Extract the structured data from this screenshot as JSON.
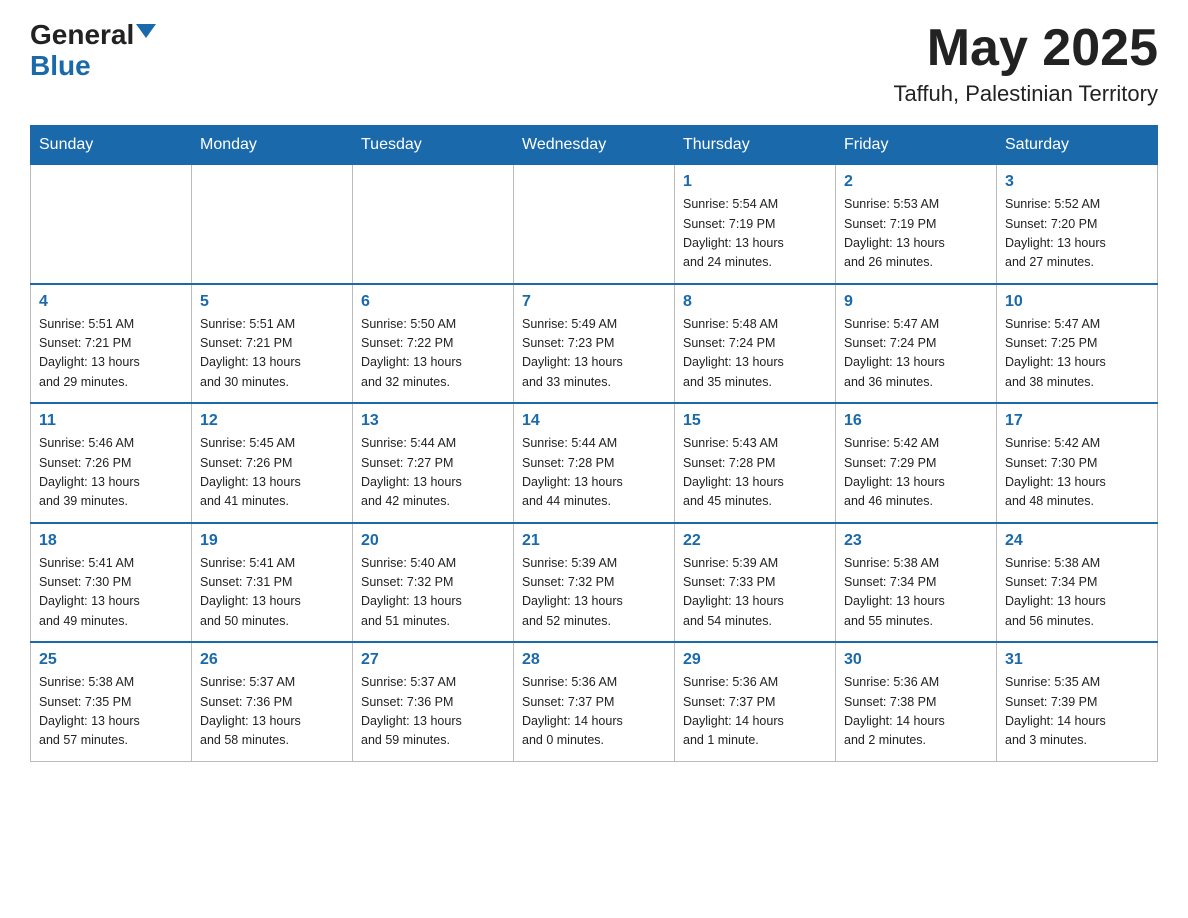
{
  "header": {
    "logo_main": "General",
    "logo_sub": "Blue",
    "title": "May 2025",
    "location": "Taffuh, Palestinian Territory"
  },
  "weekdays": [
    "Sunday",
    "Monday",
    "Tuesday",
    "Wednesday",
    "Thursday",
    "Friday",
    "Saturday"
  ],
  "weeks": [
    [
      {
        "day": "",
        "info": ""
      },
      {
        "day": "",
        "info": ""
      },
      {
        "day": "",
        "info": ""
      },
      {
        "day": "",
        "info": ""
      },
      {
        "day": "1",
        "info": "Sunrise: 5:54 AM\nSunset: 7:19 PM\nDaylight: 13 hours\nand 24 minutes."
      },
      {
        "day": "2",
        "info": "Sunrise: 5:53 AM\nSunset: 7:19 PM\nDaylight: 13 hours\nand 26 minutes."
      },
      {
        "day": "3",
        "info": "Sunrise: 5:52 AM\nSunset: 7:20 PM\nDaylight: 13 hours\nand 27 minutes."
      }
    ],
    [
      {
        "day": "4",
        "info": "Sunrise: 5:51 AM\nSunset: 7:21 PM\nDaylight: 13 hours\nand 29 minutes."
      },
      {
        "day": "5",
        "info": "Sunrise: 5:51 AM\nSunset: 7:21 PM\nDaylight: 13 hours\nand 30 minutes."
      },
      {
        "day": "6",
        "info": "Sunrise: 5:50 AM\nSunset: 7:22 PM\nDaylight: 13 hours\nand 32 minutes."
      },
      {
        "day": "7",
        "info": "Sunrise: 5:49 AM\nSunset: 7:23 PM\nDaylight: 13 hours\nand 33 minutes."
      },
      {
        "day": "8",
        "info": "Sunrise: 5:48 AM\nSunset: 7:24 PM\nDaylight: 13 hours\nand 35 minutes."
      },
      {
        "day": "9",
        "info": "Sunrise: 5:47 AM\nSunset: 7:24 PM\nDaylight: 13 hours\nand 36 minutes."
      },
      {
        "day": "10",
        "info": "Sunrise: 5:47 AM\nSunset: 7:25 PM\nDaylight: 13 hours\nand 38 minutes."
      }
    ],
    [
      {
        "day": "11",
        "info": "Sunrise: 5:46 AM\nSunset: 7:26 PM\nDaylight: 13 hours\nand 39 minutes."
      },
      {
        "day": "12",
        "info": "Sunrise: 5:45 AM\nSunset: 7:26 PM\nDaylight: 13 hours\nand 41 minutes."
      },
      {
        "day": "13",
        "info": "Sunrise: 5:44 AM\nSunset: 7:27 PM\nDaylight: 13 hours\nand 42 minutes."
      },
      {
        "day": "14",
        "info": "Sunrise: 5:44 AM\nSunset: 7:28 PM\nDaylight: 13 hours\nand 44 minutes."
      },
      {
        "day": "15",
        "info": "Sunrise: 5:43 AM\nSunset: 7:28 PM\nDaylight: 13 hours\nand 45 minutes."
      },
      {
        "day": "16",
        "info": "Sunrise: 5:42 AM\nSunset: 7:29 PM\nDaylight: 13 hours\nand 46 minutes."
      },
      {
        "day": "17",
        "info": "Sunrise: 5:42 AM\nSunset: 7:30 PM\nDaylight: 13 hours\nand 48 minutes."
      }
    ],
    [
      {
        "day": "18",
        "info": "Sunrise: 5:41 AM\nSunset: 7:30 PM\nDaylight: 13 hours\nand 49 minutes."
      },
      {
        "day": "19",
        "info": "Sunrise: 5:41 AM\nSunset: 7:31 PM\nDaylight: 13 hours\nand 50 minutes."
      },
      {
        "day": "20",
        "info": "Sunrise: 5:40 AM\nSunset: 7:32 PM\nDaylight: 13 hours\nand 51 minutes."
      },
      {
        "day": "21",
        "info": "Sunrise: 5:39 AM\nSunset: 7:32 PM\nDaylight: 13 hours\nand 52 minutes."
      },
      {
        "day": "22",
        "info": "Sunrise: 5:39 AM\nSunset: 7:33 PM\nDaylight: 13 hours\nand 54 minutes."
      },
      {
        "day": "23",
        "info": "Sunrise: 5:38 AM\nSunset: 7:34 PM\nDaylight: 13 hours\nand 55 minutes."
      },
      {
        "day": "24",
        "info": "Sunrise: 5:38 AM\nSunset: 7:34 PM\nDaylight: 13 hours\nand 56 minutes."
      }
    ],
    [
      {
        "day": "25",
        "info": "Sunrise: 5:38 AM\nSunset: 7:35 PM\nDaylight: 13 hours\nand 57 minutes."
      },
      {
        "day": "26",
        "info": "Sunrise: 5:37 AM\nSunset: 7:36 PM\nDaylight: 13 hours\nand 58 minutes."
      },
      {
        "day": "27",
        "info": "Sunrise: 5:37 AM\nSunset: 7:36 PM\nDaylight: 13 hours\nand 59 minutes."
      },
      {
        "day": "28",
        "info": "Sunrise: 5:36 AM\nSunset: 7:37 PM\nDaylight: 14 hours\nand 0 minutes."
      },
      {
        "day": "29",
        "info": "Sunrise: 5:36 AM\nSunset: 7:37 PM\nDaylight: 14 hours\nand 1 minute."
      },
      {
        "day": "30",
        "info": "Sunrise: 5:36 AM\nSunset: 7:38 PM\nDaylight: 14 hours\nand 2 minutes."
      },
      {
        "day": "31",
        "info": "Sunrise: 5:35 AM\nSunset: 7:39 PM\nDaylight: 14 hours\nand 3 minutes."
      }
    ]
  ]
}
